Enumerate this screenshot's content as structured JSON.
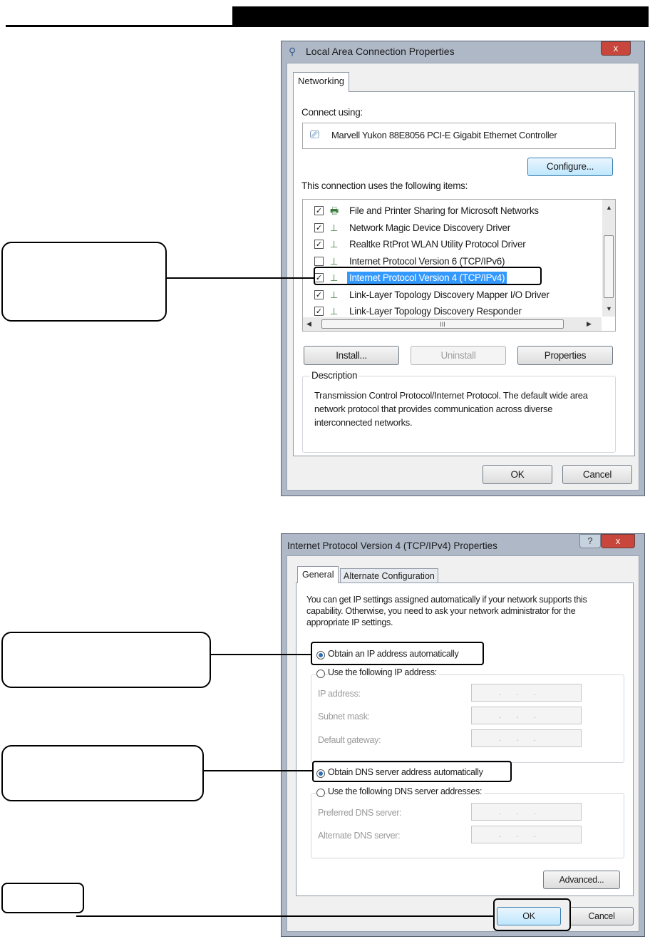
{
  "dialog1": {
    "title": "Local Area Connection Properties",
    "tab": "Networking",
    "connect_using_label": "Connect using:",
    "adapter_name": "Marvell Yukon 88E8056 PCI-E Gigabit Ethernet Controller",
    "configure_button": "Configure...",
    "items_label": "This connection uses the following items:",
    "items": [
      {
        "label": "File and Printer Sharing for Microsoft Networks",
        "checked": true
      },
      {
        "label": "Network Magic Device Discovery Driver",
        "checked": true
      },
      {
        "label": "Realtke RtProt WLAN Utility Protocol Driver",
        "checked": true
      },
      {
        "label": "Internet Protocol Version 6 (TCP/IPv6)",
        "checked": false
      },
      {
        "label": "Internet Protocol Version 4 (TCP/IPv4)",
        "checked": true,
        "selected": true
      },
      {
        "label": "Link-Layer Topology Discovery Mapper I/O Driver",
        "checked": true
      },
      {
        "label": "Link-Layer Topology Discovery Responder",
        "checked": true
      }
    ],
    "scroll_mid_glyph": "III",
    "install_button": "Install...",
    "uninstall_button": "Uninstall",
    "properties_button": "Properties",
    "description_label": "Description",
    "description_text": "Transmission Control Protocol/Internet Protocol. The default wide area network protocol that provides communication across diverse interconnected networks.",
    "ok_button": "OK",
    "cancel_button": "Cancel",
    "close_glyph": "x"
  },
  "dialog2": {
    "title": "Internet Protocol Version 4 (TCP/IPv4) Properties",
    "tab_general": "General",
    "tab_alternate": "Alternate Configuration",
    "intro_text": "You can get IP settings assigned automatically if your network supports this capability. Otherwise, you need to ask your network administrator for the appropriate IP settings.",
    "obtain_ip_auto": "Obtain an IP address automatically",
    "use_following_ip": "Use the following IP address:",
    "ip_address_label": "IP address:",
    "subnet_mask_label": "Subnet mask:",
    "default_gateway_label": "Default gateway:",
    "obtain_dns_auto": "Obtain DNS server address automatically",
    "use_following_dns": "Use the following DNS server addresses:",
    "preferred_dns_label": "Preferred DNS server:",
    "alternate_dns_label": "Alternate DNS server:",
    "ip_placeholder": "...",
    "advanced_button": "Advanced...",
    "ok_button": "OK",
    "cancel_button": "Cancel",
    "help_glyph": "?",
    "close_glyph": "x"
  },
  "colors": {
    "selection": "#3399ff",
    "window_frame": "#aeb8c6",
    "close_button": "#c8463b"
  }
}
